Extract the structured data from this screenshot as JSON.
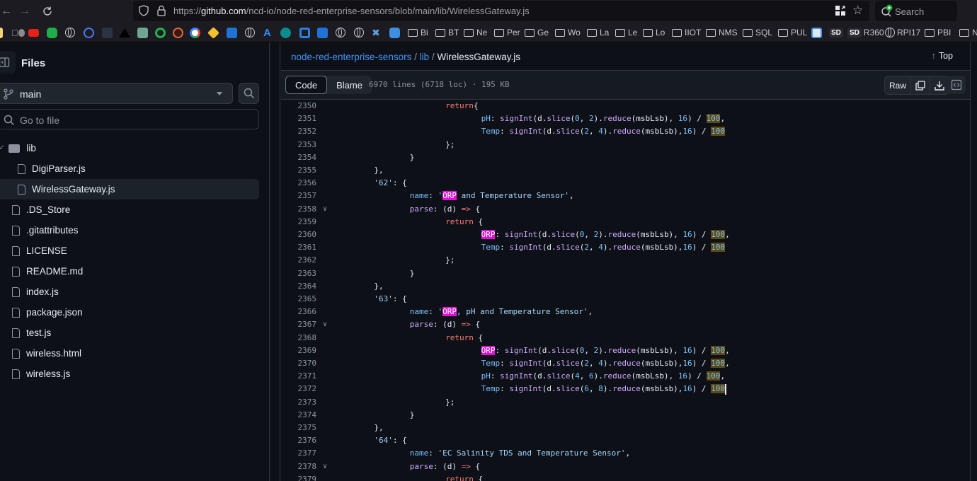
{
  "browser": {
    "url_prefix": "https://",
    "url_domain": "github.com",
    "url_path": "/ncd-io/node-red-enterprise-sensors/blob/main/lib/WirelessGateway.js",
    "search_label": "Search",
    "bookmark_folders": [
      "Bi",
      "BT",
      "Ne",
      "Per",
      "Ge",
      "Wo",
      "La",
      "Le",
      "Lo",
      "IIOT",
      "NMS",
      "SQL",
      "PUL"
    ],
    "bookmark_labels": {
      "sd_r360": "R360",
      "rpi17": "RPI17",
      "pbi": "PBI",
      "nr": "NR"
    },
    "sd_badge": "SD"
  },
  "sidebar": {
    "title": "Files",
    "branch": "main",
    "goto_placeholder": "Go to file",
    "tree": [
      {
        "name": "lib",
        "type": "folder",
        "expanded": true
      },
      {
        "name": "DigiParser.js",
        "type": "file",
        "indent": 1
      },
      {
        "name": "WirelessGateway.js",
        "type": "file",
        "indent": 1,
        "active": true
      },
      {
        "name": ".DS_Store",
        "type": "file"
      },
      {
        "name": ".gitattributes",
        "type": "file"
      },
      {
        "name": "LICENSE",
        "type": "file"
      },
      {
        "name": "README.md",
        "type": "file"
      },
      {
        "name": "index.js",
        "type": "file"
      },
      {
        "name": "package.json",
        "type": "file"
      },
      {
        "name": "test.js",
        "type": "file"
      },
      {
        "name": "wireless.html",
        "type": "file"
      },
      {
        "name": "wireless.js",
        "type": "file"
      }
    ]
  },
  "header": {
    "repo": "node-red-enterprise-sensors",
    "sep": "/",
    "dir": "lib",
    "file": "WirelessGateway.js",
    "top_label": "Top"
  },
  "filebar": {
    "code_tab": "Code",
    "blame_tab": "Blame",
    "info": "6970 lines (6718 loc) · 195 KB",
    "raw_label": "Raw"
  },
  "code": {
    "lines": [
      {
        "n": "2350",
        "indent": 6,
        "tokens": [
          [
            "kw",
            "return"
          ],
          [
            "",
            "{"
          ]
        ]
      },
      {
        "n": "2351",
        "indent": 7,
        "tokens": [
          [
            "prop",
            "pH"
          ],
          [
            "",
            ": "
          ],
          [
            "fn",
            "signInt"
          ],
          [
            "",
            "(d."
          ],
          [
            "fn",
            "slice"
          ],
          [
            "",
            "("
          ],
          [
            "num",
            "0"
          ],
          [
            "",
            ", "
          ],
          [
            "num",
            "2"
          ],
          [
            "",
            ")."
          ],
          [
            "fn",
            "reduce"
          ],
          [
            "",
            "(msbLsb), "
          ],
          [
            "num",
            "16"
          ],
          [
            "",
            ") / "
          ],
          [
            "hl-o",
            "100"
          ],
          [
            "",
            ","
          ]
        ]
      },
      {
        "n": "2352",
        "indent": 7,
        "tokens": [
          [
            "prop",
            "Temp"
          ],
          [
            "",
            ": "
          ],
          [
            "fn",
            "signInt"
          ],
          [
            "",
            "(d."
          ],
          [
            "fn",
            "slice"
          ],
          [
            "",
            "("
          ],
          [
            "num",
            "2"
          ],
          [
            "",
            ", "
          ],
          [
            "num",
            "4"
          ],
          [
            "",
            ")."
          ],
          [
            "fn",
            "reduce"
          ],
          [
            "",
            "(msbLsb),"
          ],
          [
            "num",
            "16"
          ],
          [
            "",
            ") / "
          ],
          [
            "hl-o",
            "100"
          ]
        ]
      },
      {
        "n": "2353",
        "indent": 6,
        "tokens": [
          [
            "",
            "};"
          ]
        ]
      },
      {
        "n": "2354",
        "indent": 5,
        "tokens": [
          [
            "",
            "}"
          ]
        ]
      },
      {
        "n": "2355",
        "indent": 4,
        "tokens": [
          [
            "",
            "},"
          ]
        ]
      },
      {
        "n": "2356",
        "indent": 4,
        "tokens": [
          [
            "str",
            "'62'"
          ],
          [
            "",
            ": {"
          ]
        ]
      },
      {
        "n": "2357",
        "indent": 5,
        "tokens": [
          [
            "prop",
            "name"
          ],
          [
            "",
            ": "
          ],
          [
            "str",
            "'"
          ],
          [
            "hl-m",
            "ORP"
          ],
          [
            "str",
            " and Temperature Sensor'"
          ],
          [
            "",
            ","
          ]
        ]
      },
      {
        "n": "2358",
        "indent": 5,
        "fold": true,
        "tokens": [
          [
            "fn",
            "parse"
          ],
          [
            "",
            ": (d) "
          ],
          [
            "kw",
            "=>"
          ],
          [
            "",
            " {"
          ]
        ]
      },
      {
        "n": "2359",
        "indent": 6,
        "tokens": [
          [
            "kw",
            "return"
          ],
          [
            "",
            " {"
          ]
        ]
      },
      {
        "n": "2360",
        "indent": 7,
        "tokens": [
          [
            "hl-m",
            "ORP"
          ],
          [
            "",
            ": "
          ],
          [
            "fn",
            "signInt"
          ],
          [
            "",
            "(d."
          ],
          [
            "fn",
            "slice"
          ],
          [
            "",
            "("
          ],
          [
            "num",
            "0"
          ],
          [
            "",
            ", "
          ],
          [
            "num",
            "2"
          ],
          [
            "",
            ")."
          ],
          [
            "fn",
            "reduce"
          ],
          [
            "",
            "(msbLsb), "
          ],
          [
            "num",
            "16"
          ],
          [
            "",
            ") / "
          ],
          [
            "hl-o",
            "100"
          ],
          [
            "",
            ","
          ]
        ]
      },
      {
        "n": "2361",
        "indent": 7,
        "tokens": [
          [
            "prop",
            "Temp"
          ],
          [
            "",
            ": "
          ],
          [
            "fn",
            "signInt"
          ],
          [
            "",
            "(d."
          ],
          [
            "fn",
            "slice"
          ],
          [
            "",
            "("
          ],
          [
            "num",
            "2"
          ],
          [
            "",
            ", "
          ],
          [
            "num",
            "4"
          ],
          [
            "",
            ")."
          ],
          [
            "fn",
            "reduce"
          ],
          [
            "",
            "(msbLsb),"
          ],
          [
            "num",
            "16"
          ],
          [
            "",
            ") / "
          ],
          [
            "hl-o",
            "100"
          ]
        ]
      },
      {
        "n": "2362",
        "indent": 6,
        "tokens": [
          [
            "",
            "};"
          ]
        ]
      },
      {
        "n": "2363",
        "indent": 5,
        "tokens": [
          [
            "",
            "}"
          ]
        ]
      },
      {
        "n": "2364",
        "indent": 4,
        "tokens": [
          [
            "",
            "},"
          ]
        ]
      },
      {
        "n": "2365",
        "indent": 4,
        "tokens": [
          [
            "str",
            "'63'"
          ],
          [
            "",
            ": {"
          ]
        ]
      },
      {
        "n": "2366",
        "indent": 5,
        "tokens": [
          [
            "prop",
            "name"
          ],
          [
            "",
            ": "
          ],
          [
            "str",
            "'"
          ],
          [
            "hl-m",
            "ORP"
          ],
          [
            "str",
            ", pH and Temperature Sensor'"
          ],
          [
            "",
            ","
          ]
        ]
      },
      {
        "n": "2367",
        "indent": 5,
        "fold": true,
        "tokens": [
          [
            "fn",
            "parse"
          ],
          [
            "",
            ": (d) "
          ],
          [
            "kw",
            "=>"
          ],
          [
            "",
            " {"
          ]
        ]
      },
      {
        "n": "2368",
        "indent": 6,
        "tokens": [
          [
            "kw",
            "return"
          ],
          [
            "",
            " {"
          ]
        ]
      },
      {
        "n": "2369",
        "indent": 7,
        "tokens": [
          [
            "hl-m",
            "ORP"
          ],
          [
            "",
            ": "
          ],
          [
            "fn",
            "signInt"
          ],
          [
            "",
            "(d."
          ],
          [
            "fn",
            "slice"
          ],
          [
            "",
            "("
          ],
          [
            "num",
            "0"
          ],
          [
            "",
            ", "
          ],
          [
            "num",
            "2"
          ],
          [
            "",
            ")."
          ],
          [
            "fn",
            "reduce"
          ],
          [
            "",
            "(msbLsb), "
          ],
          [
            "num",
            "16"
          ],
          [
            "",
            ") / "
          ],
          [
            "hl-o",
            "100"
          ],
          [
            "",
            ","
          ]
        ]
      },
      {
        "n": "2370",
        "indent": 7,
        "tokens": [
          [
            "prop",
            "Temp"
          ],
          [
            "",
            ": "
          ],
          [
            "fn",
            "signInt"
          ],
          [
            "",
            "(d."
          ],
          [
            "fn",
            "slice"
          ],
          [
            "",
            "("
          ],
          [
            "num",
            "2"
          ],
          [
            "",
            ", "
          ],
          [
            "num",
            "4"
          ],
          [
            "",
            ")."
          ],
          [
            "fn",
            "reduce"
          ],
          [
            "",
            "(msbLsb),"
          ],
          [
            "num",
            "16"
          ],
          [
            "",
            ") / "
          ],
          [
            "hl-o",
            "100"
          ],
          [
            "",
            ","
          ]
        ]
      },
      {
        "n": "2371",
        "indent": 7,
        "tokens": [
          [
            "prop",
            "pH"
          ],
          [
            "",
            ": "
          ],
          [
            "fn",
            "signInt"
          ],
          [
            "",
            "(d."
          ],
          [
            "fn",
            "slice"
          ],
          [
            "",
            "("
          ],
          [
            "num",
            "4"
          ],
          [
            "",
            ", "
          ],
          [
            "num",
            "6"
          ],
          [
            "",
            ")."
          ],
          [
            "fn",
            "reduce"
          ],
          [
            "",
            "(msbLsb), "
          ],
          [
            "num",
            "16"
          ],
          [
            "",
            ") / "
          ],
          [
            "hl-o",
            "100"
          ],
          [
            "",
            ","
          ]
        ]
      },
      {
        "n": "2372",
        "indent": 7,
        "cursor": true,
        "tokens": [
          [
            "prop",
            "Temp"
          ],
          [
            "",
            ": "
          ],
          [
            "fn",
            "signInt"
          ],
          [
            "",
            "(d."
          ],
          [
            "fn",
            "slice"
          ],
          [
            "",
            "("
          ],
          [
            "num",
            "6"
          ],
          [
            "",
            ", "
          ],
          [
            "num",
            "8"
          ],
          [
            "",
            ")."
          ],
          [
            "fn",
            "reduce"
          ],
          [
            "",
            "(msbLsb),"
          ],
          [
            "num",
            "16"
          ],
          [
            "",
            ") / "
          ],
          [
            "hl-o",
            "100"
          ]
        ]
      },
      {
        "n": "2373",
        "indent": 6,
        "tokens": [
          [
            "",
            "};"
          ]
        ]
      },
      {
        "n": "2374",
        "indent": 5,
        "tokens": [
          [
            "",
            "}"
          ]
        ]
      },
      {
        "n": "2375",
        "indent": 4,
        "tokens": [
          [
            "",
            "},"
          ]
        ]
      },
      {
        "n": "2376",
        "indent": 4,
        "tokens": [
          [
            "str",
            "'64'"
          ],
          [
            "",
            ": {"
          ]
        ]
      },
      {
        "n": "2377",
        "indent": 5,
        "tokens": [
          [
            "prop",
            "name"
          ],
          [
            "",
            ": "
          ],
          [
            "str",
            "'EC Salinity TDS and Temperature Sensor'"
          ],
          [
            "",
            ","
          ]
        ]
      },
      {
        "n": "2378",
        "indent": 5,
        "fold": true,
        "tokens": [
          [
            "fn",
            "parse"
          ],
          [
            "",
            ": (d) "
          ],
          [
            "kw",
            "=>"
          ],
          [
            "",
            " {"
          ]
        ]
      },
      {
        "n": "2379",
        "indent": 6,
        "tokens": [
          [
            "kw",
            "return"
          ],
          [
            "",
            " {"
          ]
        ]
      }
    ]
  },
  "colors": {
    "accent_link": "#4493f8",
    "background": "#0d1117",
    "search_highlight": "#e010d8",
    "selection_highlight": "#5c4a12"
  }
}
